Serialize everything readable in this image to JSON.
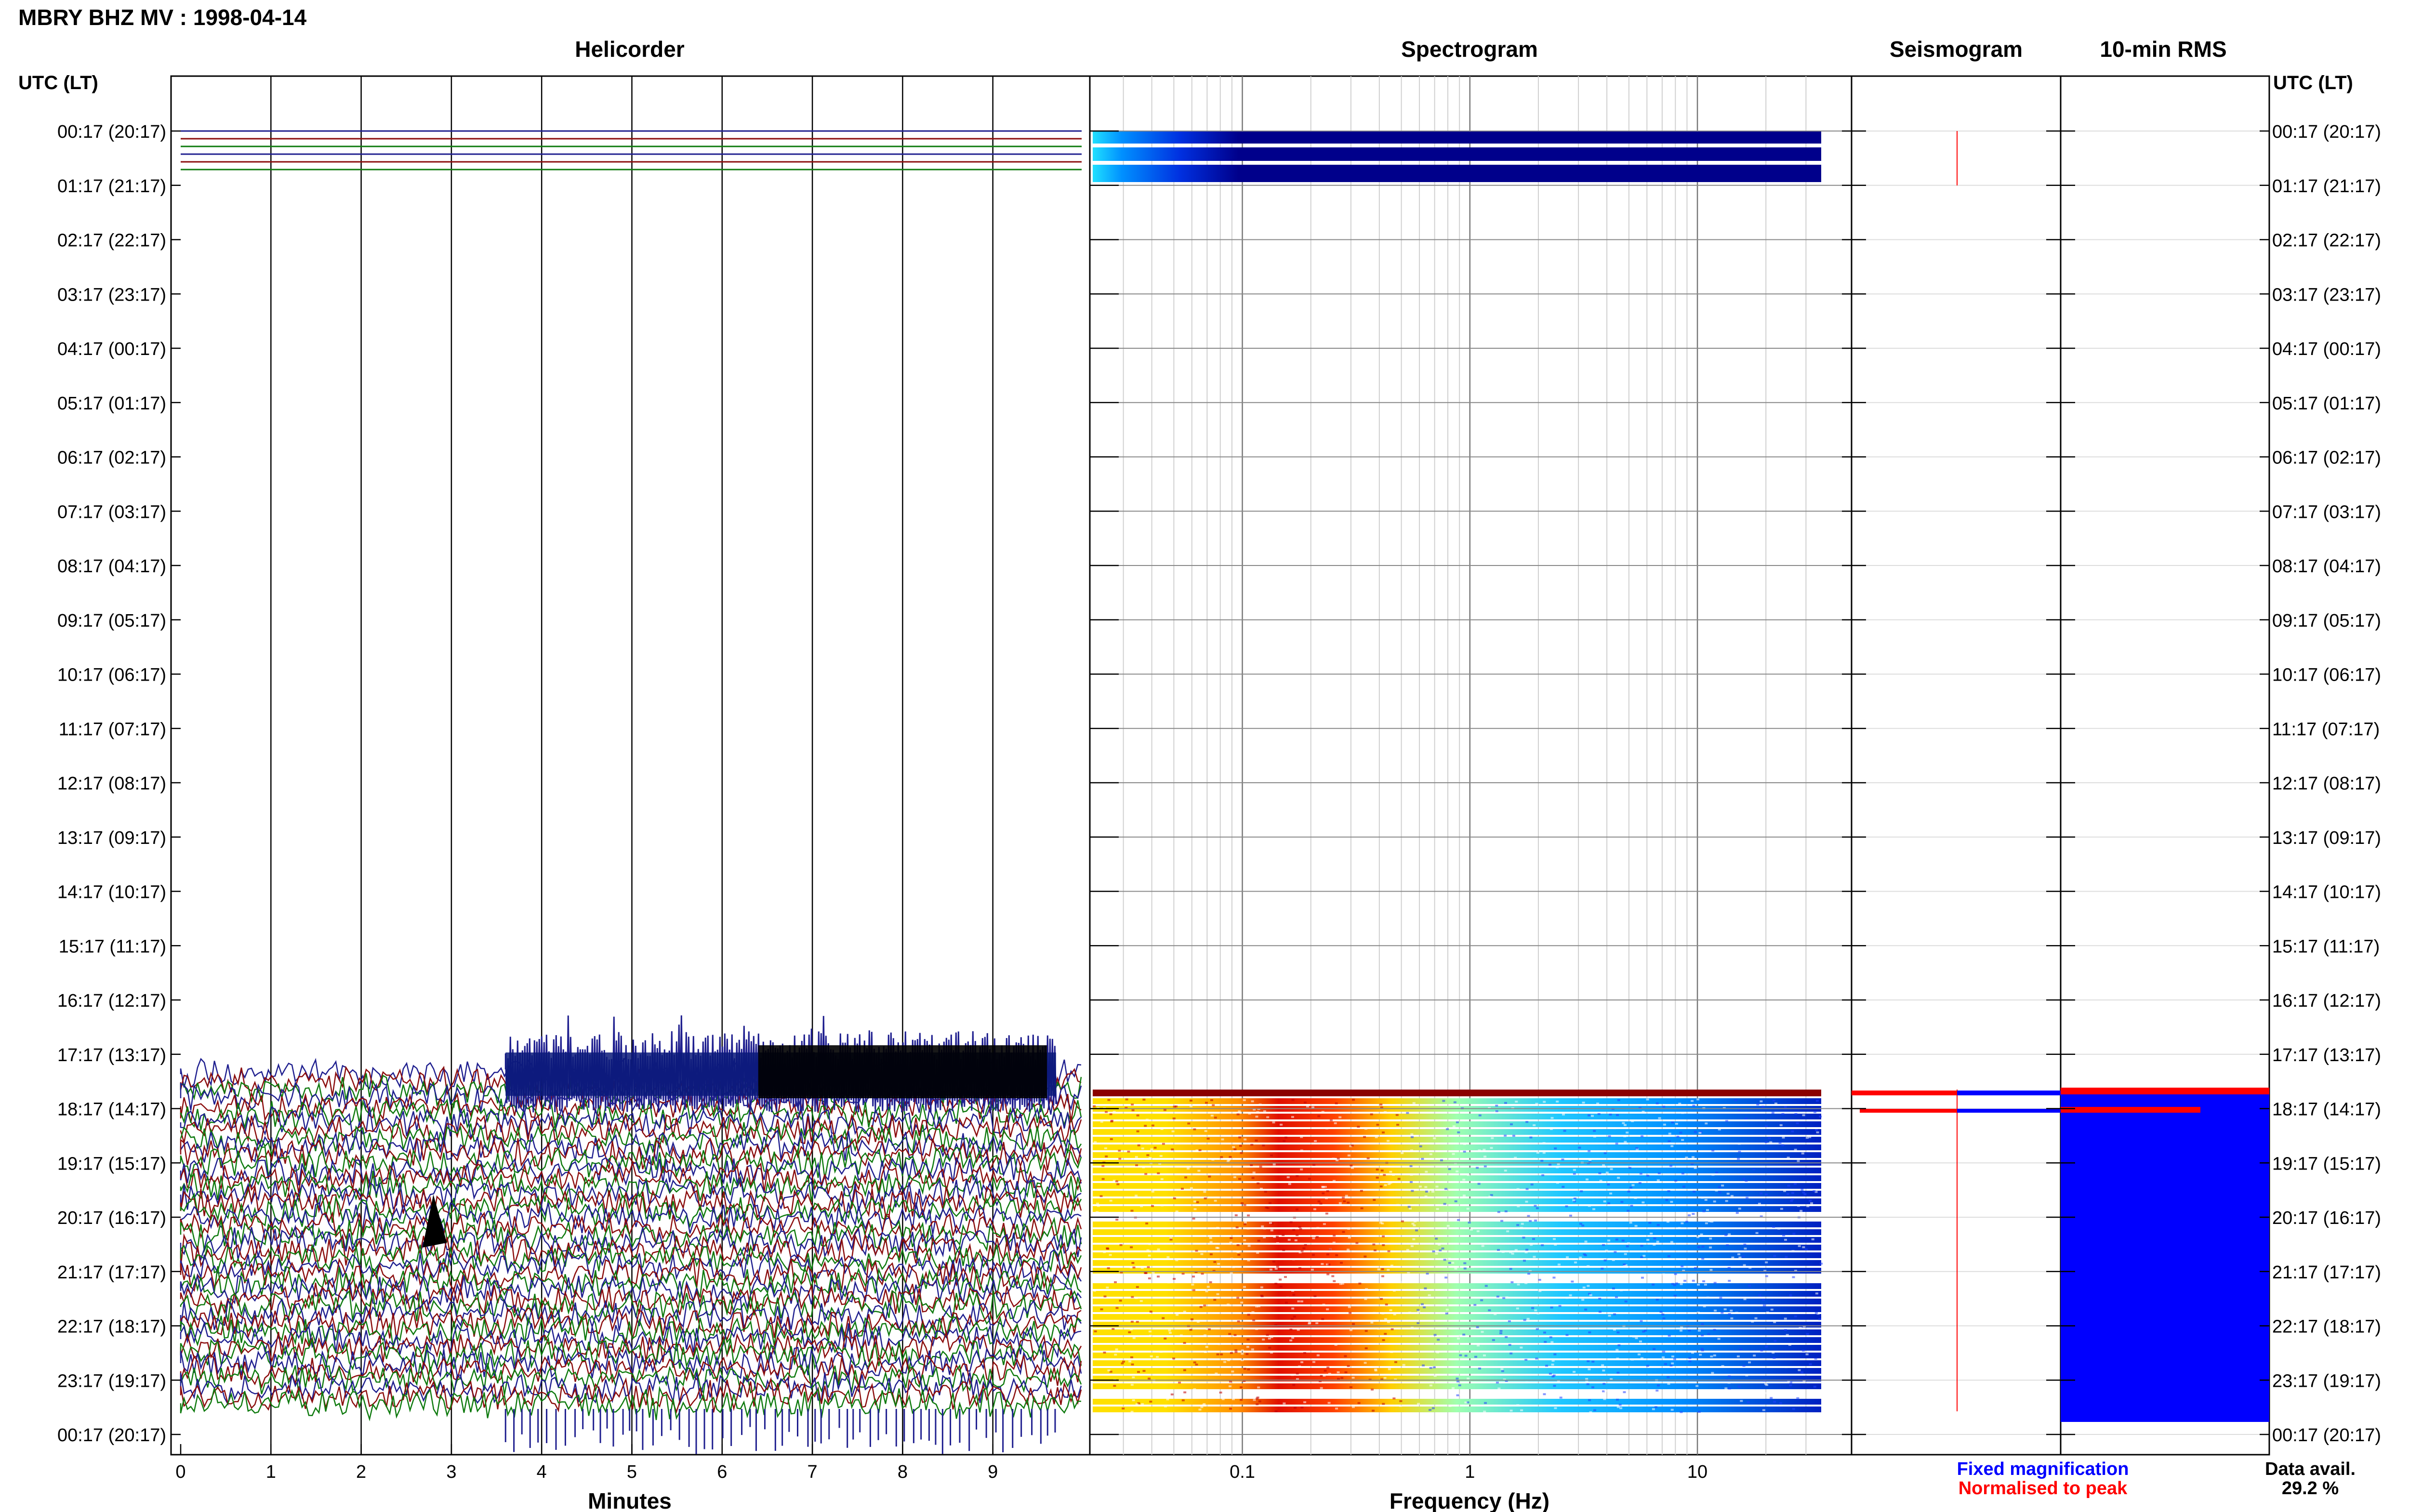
{
  "header": {
    "station_title": "MBRY BHZ MV : 1998-04-14"
  },
  "panels": {
    "helicorder": "Helicorder",
    "spectrogram": "Spectrogram",
    "seismogram": "Seismogram",
    "rms": "10-min RMS"
  },
  "axes": {
    "left_header": "UTC (LT)",
    "right_header": "UTC (LT)",
    "minutes_label": "Minutes",
    "frequency_label": "Frequency (Hz)"
  },
  "legend": {
    "fixed": "Fixed magnification",
    "normalised": "Normalised to peak",
    "data_avail_label": "Data avail.",
    "data_avail_value": "29.2 %"
  },
  "colors": {
    "trace_blue": "#1f1f8f",
    "trace_red": "#8b0d0d",
    "trace_green": "#0e7a0e",
    "fixed_blue": "#0000ff",
    "normalised_red": "#ff0000",
    "rms_blue": "#0000ff",
    "spec_background": "#00008b"
  },
  "chart_data": {
    "type": "heatmap",
    "time_labels": [
      "00:17 (20:17)",
      "01:17 (21:17)",
      "02:17 (22:17)",
      "03:17 (23:17)",
      "04:17 (00:17)",
      "05:17 (01:17)",
      "06:17 (02:17)",
      "07:17 (03:17)",
      "08:17 (04:17)",
      "09:17 (05:17)",
      "10:17 (06:17)",
      "11:17 (07:17)",
      "12:17 (08:17)",
      "13:17 (09:17)",
      "14:17 (10:17)",
      "15:17 (11:17)",
      "16:17 (12:17)",
      "17:17 (13:17)",
      "18:17 (14:17)",
      "19:17 (15:17)",
      "20:17 (16:17)",
      "21:17 (17:17)",
      "22:17 (18:17)",
      "23:17 (19:17)",
      "00:17 (20:17)"
    ],
    "minutes_ticks": [
      "0",
      "1",
      "2",
      "3",
      "4",
      "5",
      "6",
      "7",
      "8",
      "9"
    ],
    "frequency_ticks": [
      "0.1",
      "1",
      "10"
    ],
    "frequency_scale": "log",
    "frequency_range_hz": [
      0.022,
      35
    ],
    "minutes_range": [
      0,
      10
    ],
    "data_segments": [
      {
        "start": "00:17",
        "end": "01:17"
      },
      {
        "start": "18:17",
        "end": "00:17"
      }
    ],
    "spectral_peak_hz": [
      0.2,
      0.5
    ],
    "data_availability_percent": 29.2
  }
}
